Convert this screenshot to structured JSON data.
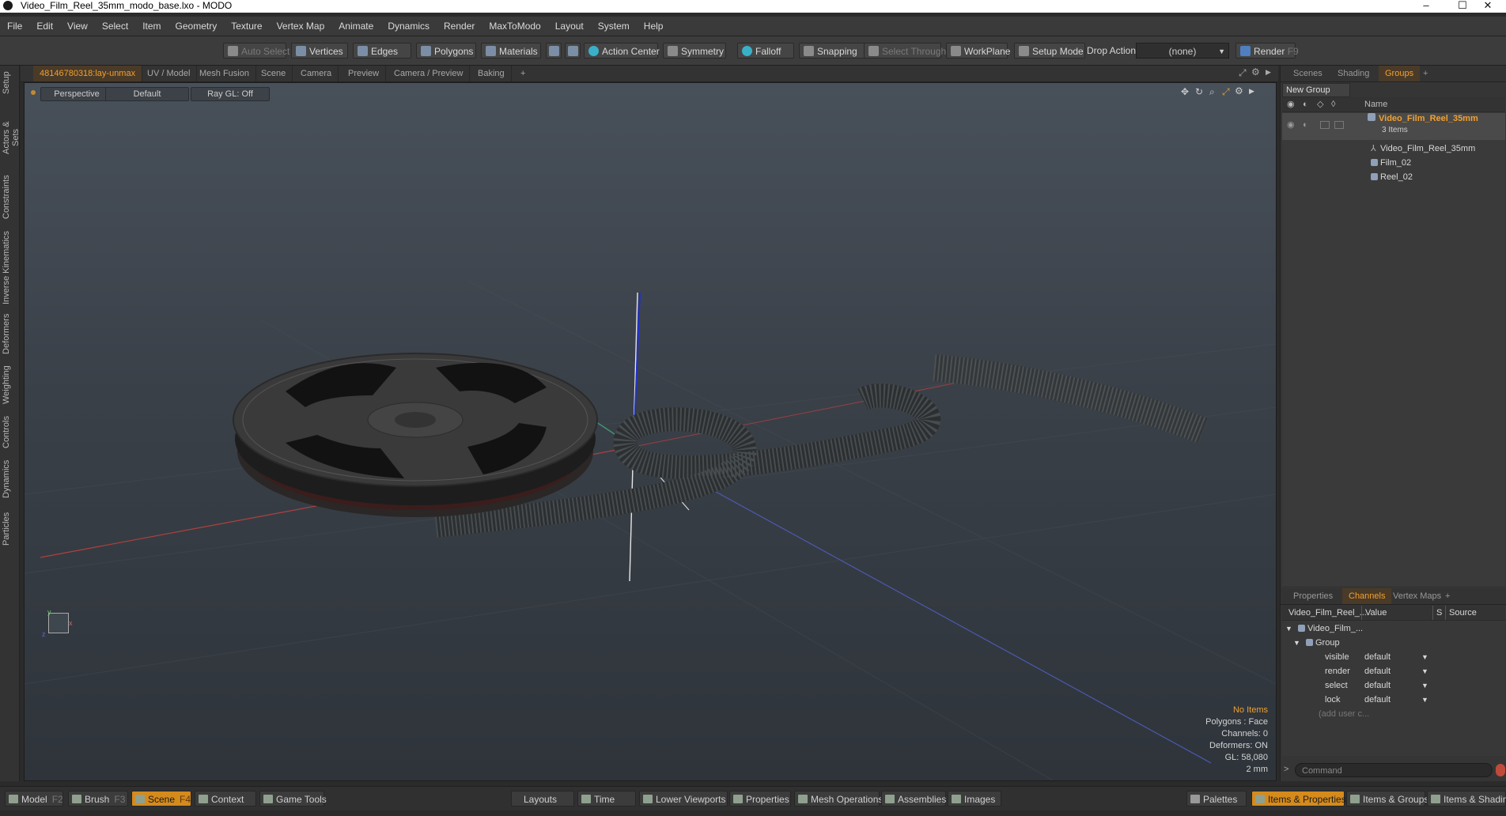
{
  "window": {
    "title": "Video_Film_Reel_35mm_modo_base.lxo - MODO",
    "minimize": "–",
    "maximize": "☐",
    "close": "✕"
  },
  "menu": [
    "File",
    "Edit",
    "View",
    "Select",
    "Item",
    "Geometry",
    "Texture",
    "Vertex Map",
    "Animate",
    "Dynamics",
    "Render",
    "MaxToModo",
    "Layout",
    "System",
    "Help"
  ],
  "toolbar": {
    "auto_select": "Auto Select",
    "vertices": "Vertices",
    "edges": "Edges",
    "polygons": "Polygons",
    "materials": "Materials",
    "action_center": "Action Center",
    "symmetry": "Symmetry",
    "falloff": "Falloff",
    "snapping": "Snapping",
    "select_through": "Select Through",
    "workplane": "WorkPlane",
    "setup_mode": "Setup Mode",
    "drop_action": "Drop Action",
    "drop_value": "(none)",
    "render": "Render",
    "render_key": "F9"
  },
  "left_tabs": [
    "Setup",
    "Actors & Sets",
    "Constraints",
    "Inverse Kinematics",
    "Deformers",
    "Weighting",
    "Controls",
    "Dynamics",
    "Particles"
  ],
  "viewport_tabs": [
    "48146780318:lay-unmax",
    "UV / Model",
    "Mesh Fusion",
    "Scene",
    "Camera",
    "Preview",
    "Camera / Preview",
    "Baking",
    "+"
  ],
  "viewport": {
    "view": "Perspective",
    "style": "Default",
    "raygl": "Ray GL: Off",
    "stats": {
      "items": "No Items",
      "polygons": "Polygons : Face",
      "channels": "Channels: 0",
      "deformers": "Deformers: ON",
      "gl": "GL: 58,080",
      "unit": "2 mm"
    }
  },
  "groups_panel": {
    "tabs": [
      "Scenes",
      "Shading",
      "Groups",
      "+"
    ],
    "new_group": "New Group",
    "name_header": "Name",
    "group_name": "Video_Film_Reel_35mm",
    "group_count": "3 Items",
    "items": [
      "Video_Film_Reel_35mm",
      "Film_02",
      "Reel_02"
    ]
  },
  "channels_panel": {
    "tabs": [
      "Properties",
      "Channels",
      "Vertex Maps",
      "+"
    ],
    "headers": {
      "name": "Video_Film_Reel_...",
      "value": "Value",
      "s": "S",
      "source": "Source"
    },
    "root": "Video_Film_...",
    "group": "Group",
    "rows": [
      {
        "name": "visible",
        "value": "default"
      },
      {
        "name": "render",
        "value": "default"
      },
      {
        "name": "select",
        "value": "default"
      },
      {
        "name": "lock",
        "value": "default"
      }
    ],
    "add_user": "(add user c..."
  },
  "command": {
    "placeholder": "Command",
    "prompt": ">"
  },
  "bottom_bar": {
    "model": "Model",
    "model_key": "F2",
    "brush": "Brush",
    "brush_key": "F3",
    "scene": "Scene",
    "scene_key": "F4",
    "context": "Context",
    "game_tools": "Game Tools",
    "layouts": "Layouts",
    "time": "Time",
    "lower_viewports": "Lower Viewports",
    "properties": "Properties",
    "mesh_operations": "Mesh Operations",
    "assemblies": "Assemblies",
    "images": "Images",
    "palettes": "Palettes",
    "items_properties": "Items & Properties",
    "items_groups": "Items & Groups",
    "items_shading": "Items & Shading"
  },
  "colors": {
    "accent": "#f0a030",
    "active_tab_bg": "#4a3a28",
    "scene_button": "#d58a1c"
  }
}
